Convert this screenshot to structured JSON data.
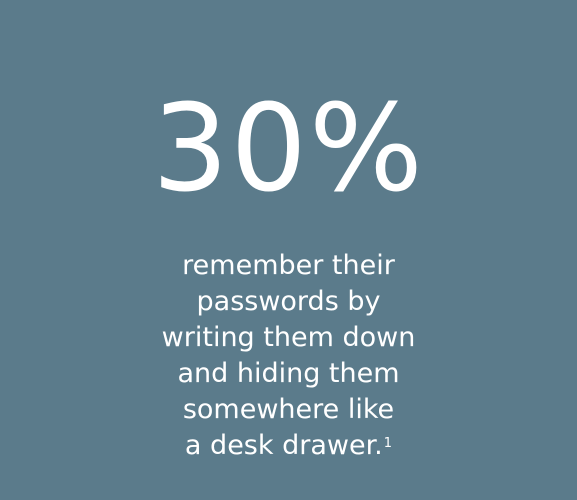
{
  "stat": {
    "value": "30%"
  },
  "caption": {
    "lines": [
      "remember their",
      "passwords by",
      "writing them down",
      "and hiding them",
      "somewhere like",
      "a desk drawer."
    ],
    "footnote_marker": "1"
  },
  "colors": {
    "background": "#5b7b8b",
    "text": "#ffffff"
  }
}
